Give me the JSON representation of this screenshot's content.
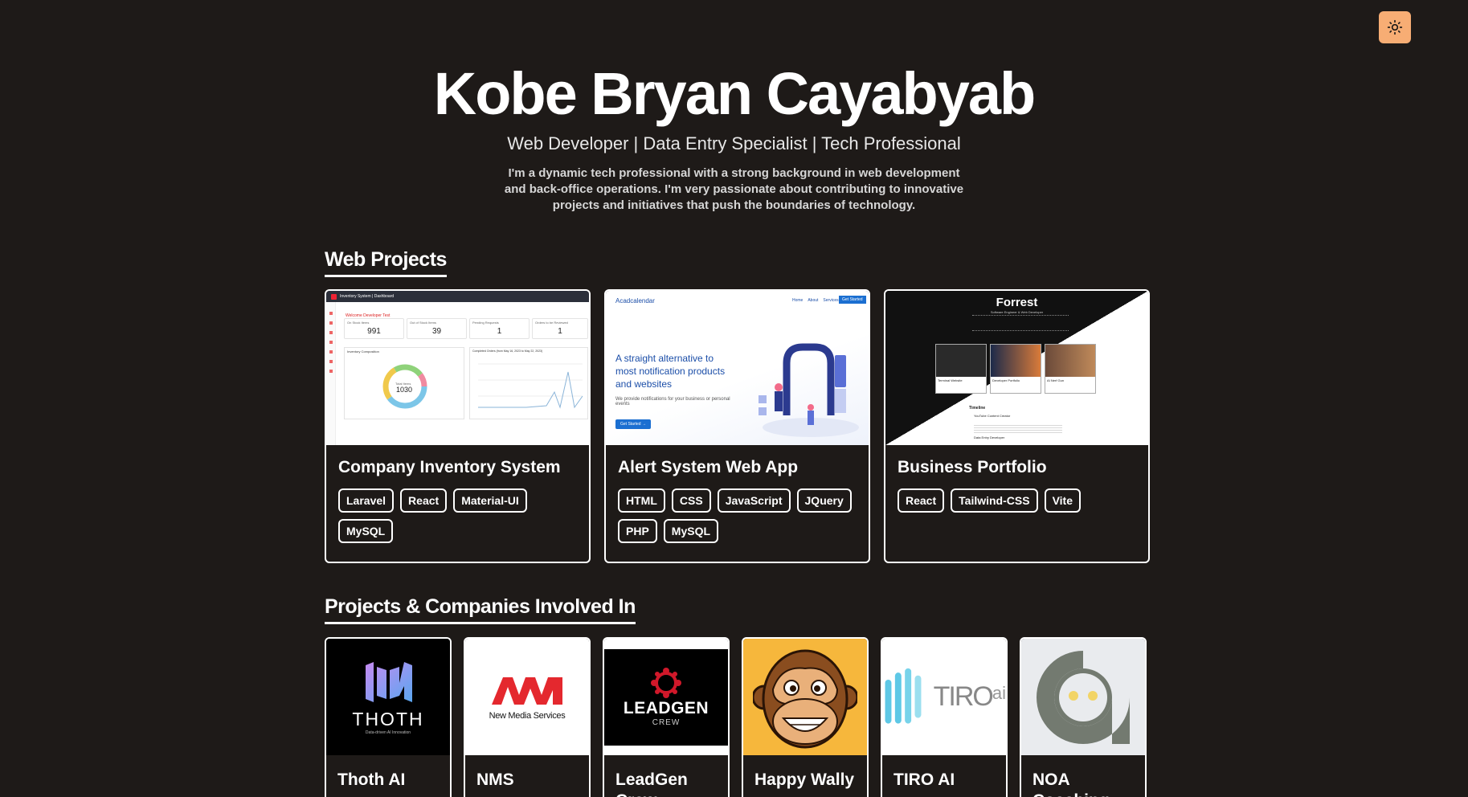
{
  "header": {
    "name": "Kobe Bryan Cayabyab",
    "subtitle": "Web Developer | Data Entry Specialist | Tech Professional",
    "bio": "I'm a dynamic tech professional with a strong background in web development and back-office operations. I'm very passionate about contributing to innovative projects and initiatives that push the boundaries of technology.",
    "theme_toggle_icon": "sun-icon"
  },
  "web_projects": {
    "title": "Web Projects",
    "items": [
      {
        "title": "Company Inventory System",
        "tags": [
          "Laravel",
          "React",
          "Material-UI",
          "MySQL"
        ],
        "thumbnail": {
          "top_bar": "Inventory System | Dashboard",
          "welcome": "Welcome Developer Test",
          "stats": [
            {
              "label": "On Stock Items",
              "value": "991"
            },
            {
              "label": "Out of Stock Items",
              "value": "39"
            },
            {
              "label": "Pending Requests",
              "value": "1"
            },
            {
              "label": "Orders to be Reviewed",
              "value": "1"
            }
          ],
          "donut_title": "Inventory Composition",
          "donut_center_label": "Total Items",
          "donut_center_value": "1030",
          "line_title": "Completed Orders (from May 16, 2023 to May 22, 2023)"
        }
      },
      {
        "title": "Alert System Web App",
        "tags": [
          "HTML",
          "CSS",
          "JavaScript",
          "JQuery",
          "PHP",
          "MySQL"
        ],
        "thumbnail": {
          "brand": "Acadcalendar",
          "nav": [
            "Home",
            "About",
            "Services"
          ],
          "nav_button": "Get Started",
          "headline": "A straight alternative to most notification products and websites",
          "sub": "We provide notifications for your business or personal events",
          "cta": "Get Started →"
        }
      },
      {
        "title": "Business Portfolio",
        "tags": [
          "React",
          "Tailwind-CSS",
          "Vite"
        ],
        "thumbnail": {
          "name": "Forrest",
          "role": "Software Engineer & Web Developer",
          "cards": [
            "Terminal Website",
            "Developer Portfolio",
            "AI Nerf Gun"
          ],
          "timeline_title": "Timeline",
          "timeline_items": [
            "YouTube Content Creator",
            "Data Entry Developer"
          ]
        }
      }
    ]
  },
  "companies": {
    "title": "Projects & Companies Involved In",
    "items": [
      {
        "name": "Thoth AI",
        "logo_text": "THOTH",
        "logo_sub": "Data-driven AI Innovation",
        "bg": "#000000"
      },
      {
        "name": "NMS",
        "logo_text": "New Media Services",
        "bg": "#ffffff"
      },
      {
        "name": "LeadGen Crew",
        "logo_text": "LEADGEN",
        "logo_sub": "CREW",
        "bg": "#ffffff"
      },
      {
        "name": "Happy Wally",
        "bg": "#f6b73c"
      },
      {
        "name": "TIRO AI",
        "logo_text": "TIRO",
        "logo_sub": "ai",
        "bg": "#ffffff"
      },
      {
        "name": "NOA Coaching",
        "bg": "#e9ebee"
      }
    ]
  },
  "colors": {
    "background": "#1e1a18",
    "toggle": "#f7ad74",
    "text": "#ffffff"
  }
}
